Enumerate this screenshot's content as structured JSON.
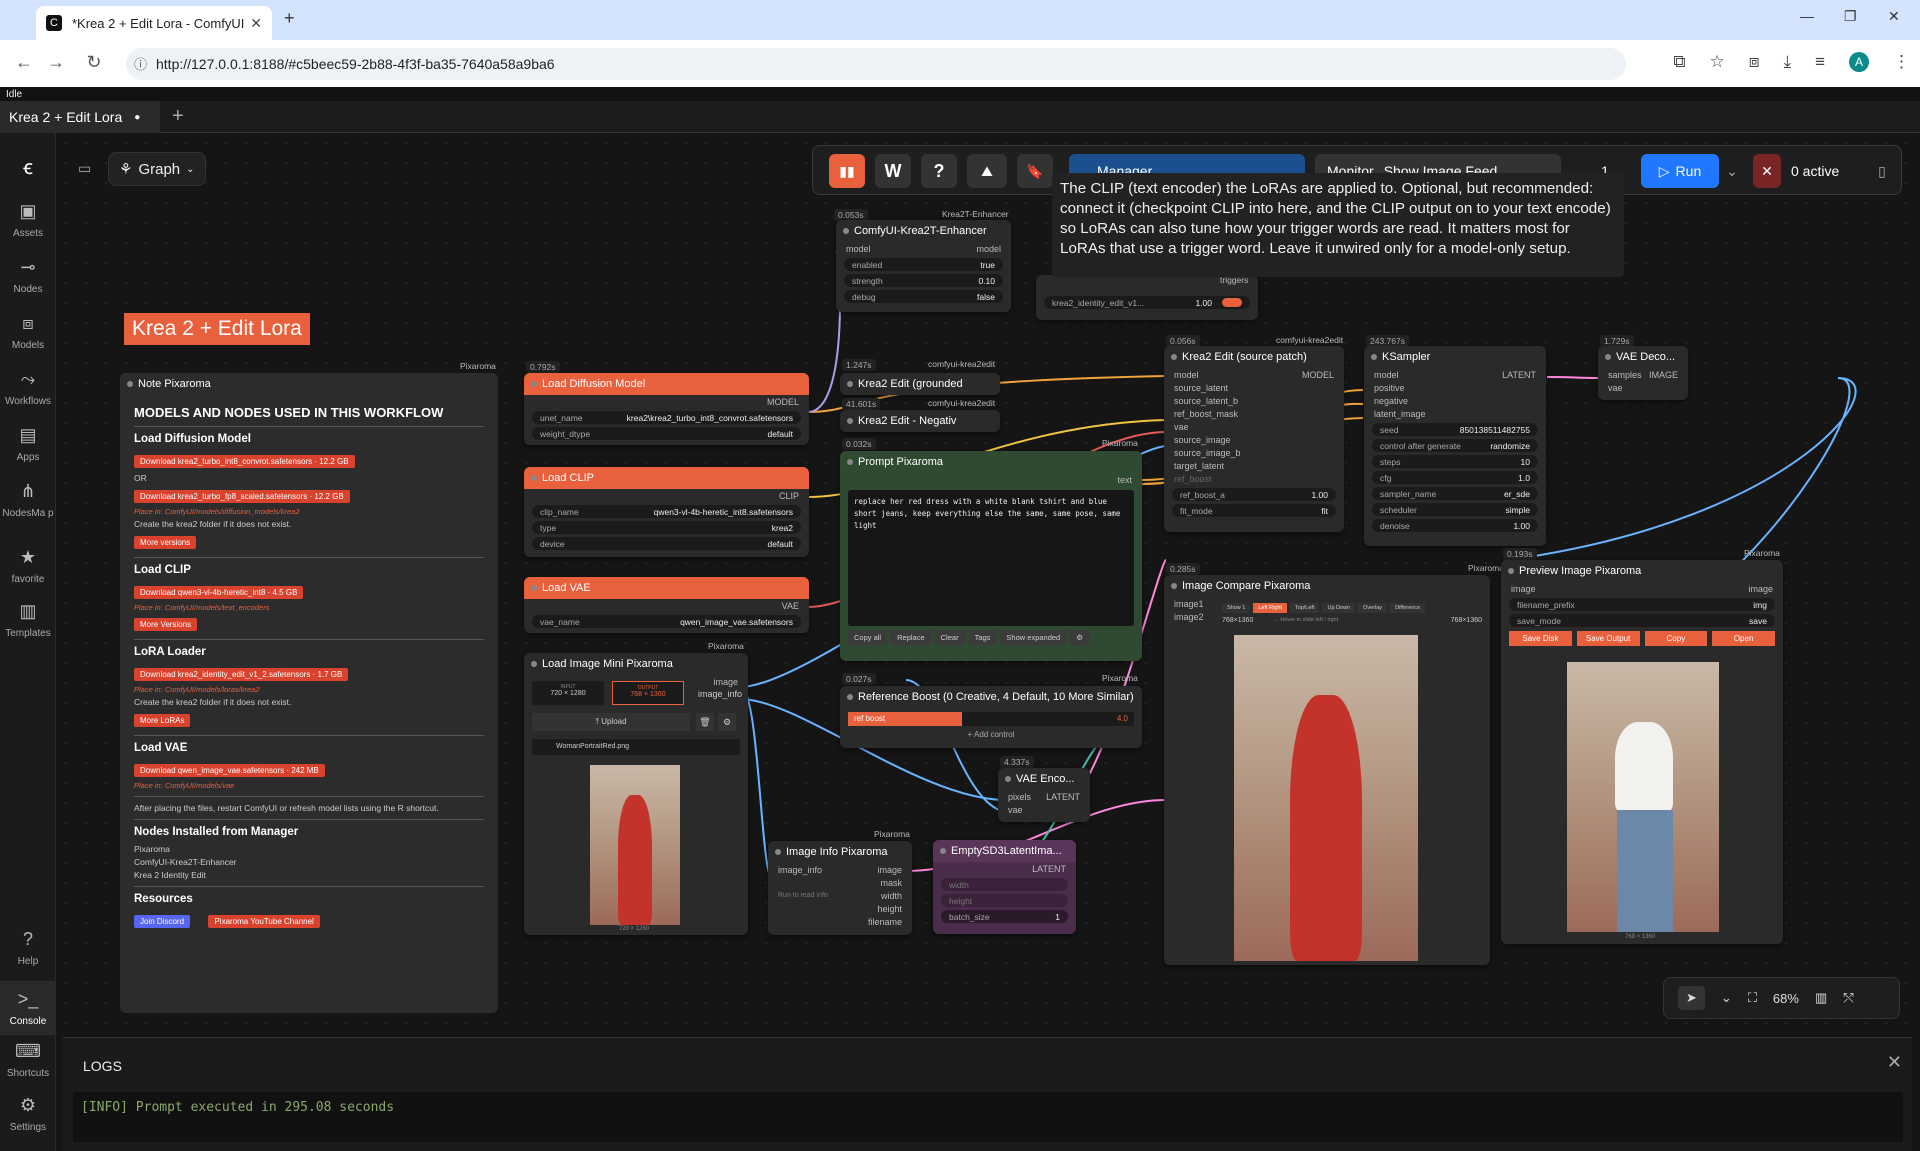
{
  "browser": {
    "tab_title": "*Krea 2 + Edit Lora - ComfyUI",
    "url": "http://127.0.0.1:8188/#c5beec59-2b88-4f3f-ba35-7640a58a9ba6",
    "profile": "A"
  },
  "app": {
    "status": "Idle",
    "workflow_tab": "Krea 2 + Edit Lora",
    "graph_label": "Graph"
  },
  "sidebar": [
    {
      "label": "Assets",
      "icon": "image-icon"
    },
    {
      "label": "Nodes",
      "icon": "link-icon"
    },
    {
      "label": "Models",
      "icon": "cube-icon"
    },
    {
      "label": "Workflows",
      "icon": "flow-icon"
    },
    {
      "label": "Apps",
      "icon": "grid-icon"
    },
    {
      "label": "NodesMa p",
      "icon": "tree-icon"
    },
    {
      "label": "favorite",
      "icon": "star-icon"
    },
    {
      "label": "Templates",
      "icon": "templates-icon"
    },
    {
      "label": "Help",
      "icon": "help-icon"
    },
    {
      "label": "Console",
      "icon": "console-icon"
    },
    {
      "label": "Shortcuts",
      "icon": "keyboard-icon"
    },
    {
      "label": "Settings",
      "icon": "gear-icon"
    }
  ],
  "toolbar": {
    "w": "W",
    "q": "?",
    "manager": "Manager",
    "monitor": "Monitor",
    "show_image_feed": "Show Image Feed",
    "queue_count": "1",
    "run": "Run",
    "active": "0 active"
  },
  "tooltip": "The CLIP (text encoder) the LoRAs are applied to. Optional, but recommended: connect it (checkpoint CLIP into here, and the CLIP output on to your text encode) so LoRAs can also tune how your trigger words are read. It matters most for LoRAs that use a trigger word. Leave it unwired only for a model-only setup.",
  "canvas_title": "Krea 2 + Edit Lora",
  "note": {
    "title": "Note Pixaroma",
    "tag": "Pixaroma",
    "heading": "MODELS AND NODES USED IN THIS WORKFLOW",
    "s1": "Load Diffusion Model",
    "d1a": "Download krea2_turbo_int8_convrot.safetensors  · 12.2 GB",
    "or": "OR",
    "d1b": "Download krea2_turbo_fp8_scaled.safetensors  · 12.2 GB",
    "p1": "Place in: ComfyUI/models/diffusion_models/krea2",
    "c1": "Create the  krea2  folder if it does not exist.",
    "m1": "More versions",
    "s2": "Load CLIP",
    "d2": "Download qwen3-vl-4b-heretic_int8  · 4.5 GB",
    "p2": "Place in: ComfyUI/models/text_encoders",
    "m2": "More Versions",
    "s3": "LoRA Loader",
    "d3": "Download krea2_identity_edit_v1_2.safetensors  · 1.7 GB",
    "p3": "Place in: ComfyUI/models/loras/krea2",
    "c3": "Create the  krea2  folder if it does not exist.",
    "m3": "More LoRAs",
    "s4": "Load VAE",
    "d4": "Download qwen_image_vae.safetensors  · 242 MB",
    "p4": "Place in: ComfyUI/models/vae",
    "warn": "After placing the files, restart ComfyUI or refresh model lists using the R shortcut.",
    "s5": "Nodes Installed from Manager",
    "li1": "Pixaroma",
    "li2": "ComfyUI-Krea2T-Enhancer",
    "li3": "Krea 2 Identity Edit",
    "s6": "Resources",
    "r1": "Join Discord",
    "r2": "Pixaroma YouTube Channel"
  },
  "nodes": {
    "ldm": {
      "title": "Load Diffusion Model",
      "time": "0.792s",
      "out": "MODEL",
      "unet_k": "unet_name",
      "unet_v": "krea2\\krea2_turbo_int8_convrot.safetensors",
      "dt_k": "weight_dtype",
      "dt_v": "default"
    },
    "clip": {
      "title": "Load CLIP",
      "out": "CLIP",
      "n_k": "clip_name",
      "n_v": "qwen3-vl-4b-heretic_int8.safetensors",
      "t_k": "type",
      "t_v": "krea2",
      "d_k": "device",
      "d_v": "default"
    },
    "vae": {
      "title": "Load VAE",
      "out": "VAE",
      "k": "vae_name",
      "v": "qwen_image_vae.safetensors"
    },
    "enh": {
      "title": "ComfyUI-Krea2T-Enhancer",
      "time": "0.053s",
      "tag": "Krea2T-Enhancer",
      "in": "model",
      "out": "model",
      "e_k": "enabled",
      "e_v": "true",
      "s_k": "strength",
      "s_v": "0.10",
      "d_k": "debug",
      "d_v": "false"
    },
    "lora": {
      "name": "krea2_identity_edit_v1...",
      "str": "1.00",
      "triggers": "triggers"
    },
    "kg": {
      "title": "Krea2 Edit (grounded",
      "time": "1.247s",
      "tag": "comfyui-krea2edit"
    },
    "kn": {
      "title": "Krea2 Edit - Negativ",
      "time": "41.601s",
      "tag": "comfyui-krea2edit"
    },
    "prompt": {
      "title": "Prompt Pixaroma",
      "time": "0.032s",
      "tag": "Pixaroma",
      "label": "text",
      "text": "replace her red dress with a white blank tshirt and blue short jeans, keep everything else the same, same pose, same light",
      "b1": "Copy all",
      "b2": "Replace",
      "b3": "Clear",
      "b4": "Tags",
      "b5": "Show expanded"
    },
    "ref": {
      "title": "Reference Boost (0 Creative, 4 Default, 10 More Similar)",
      "time": "0.027s",
      "tag": "Pixaroma",
      "k": "ref boost",
      "v": "4.0",
      "add": "+ Add control"
    },
    "ksrc": {
      "title": "Krea2 Edit (source patch)",
      "time": "0.056s",
      "tag": "comfyui-krea2edit",
      "ins": [
        "model",
        "source_latent",
        "source_latent_b",
        "ref_boost_mask",
        "vae",
        "source_image",
        "source_image_b",
        "target_latent",
        "ref_boost"
      ],
      "out": "MODEL",
      "rb_k": "ref_boost_a",
      "rb_v": "1.00",
      "fit_k": "fit_mode",
      "fit_v": "fit"
    },
    "ks": {
      "title": "KSampler",
      "time": "243.767s",
      "ins": [
        "model",
        "positive",
        "negative",
        "latent_image"
      ],
      "out": "LATENT",
      "w": [
        [
          "seed",
          "850138511482755"
        ],
        [
          "control after generate",
          "randomize"
        ],
        [
          "steps",
          "10"
        ],
        [
          "cfg",
          "1.0"
        ],
        [
          "sampler_name",
          "er_sde"
        ],
        [
          "scheduler",
          "simple"
        ],
        [
          "denoise",
          "1.00"
        ]
      ]
    },
    "vd": {
      "title": "VAE Deco...",
      "time": "1.729s",
      "i1": "samples",
      "i2": "vae",
      "out": "IMAGE"
    },
    "lim": {
      "title": "Load Image Mini Pixaroma",
      "tag": "Pixaroma",
      "o1": "image",
      "o2": "image_info",
      "in_lbl": "INPUT",
      "in_v": "720 × 1280",
      "out_lbl": "OUTPUT",
      "out_v": "768 × 1360",
      "upload": "Upload",
      "file": "WomanPortraitRed.png",
      "dims": "720 × 1280"
    },
    "ii": {
      "title": "Image Info Pixaroma",
      "tag": "Pixaroma",
      "in": "image_info",
      "outs": [
        "image",
        "mask",
        "width",
        "height",
        "filename"
      ],
      "run": "Run to read info"
    },
    "venc": {
      "title": "VAE Enco...",
      "time": "4.337s",
      "i1": "pixels",
      "i2": "vae",
      "out": "LATENT"
    },
    "esd": {
      "title": "EmptySD3LatentIma...",
      "out": "LATENT",
      "w1": "width",
      "w2": "height",
      "b_k": "batch_size",
      "b_v": "1"
    },
    "cmp": {
      "title": "Image Compare Pixaroma",
      "time": "0.285s",
      "tag": "Pixaroma",
      "i1": "image1",
      "i2": "image2",
      "modes": [
        "Show 1",
        "Left Right",
        "Top/Left",
        "Up Down",
        "Overlay",
        "Difference"
      ],
      "l": "768×1360",
      "hint": "← Hover to slide left / right",
      "r": "768×1360"
    },
    "prev": {
      "title": "Preview Image Pixaroma",
      "time": "0.193s",
      "tag": "Pixaroma",
      "in": "image",
      "out": "image",
      "fp_k": "filename_prefix",
      "fp_v": "img",
      "sm_k": "save_mode",
      "sm_v": "save",
      "b1": "Save Disk",
      "b2": "Save Output",
      "b3": "Copy",
      "b4": "Open",
      "dims": "768 × 1360"
    }
  },
  "zoom": "68%",
  "logs": {
    "title": "LOGS",
    "line": "[INFO] Prompt executed in 295.08 seconds"
  }
}
